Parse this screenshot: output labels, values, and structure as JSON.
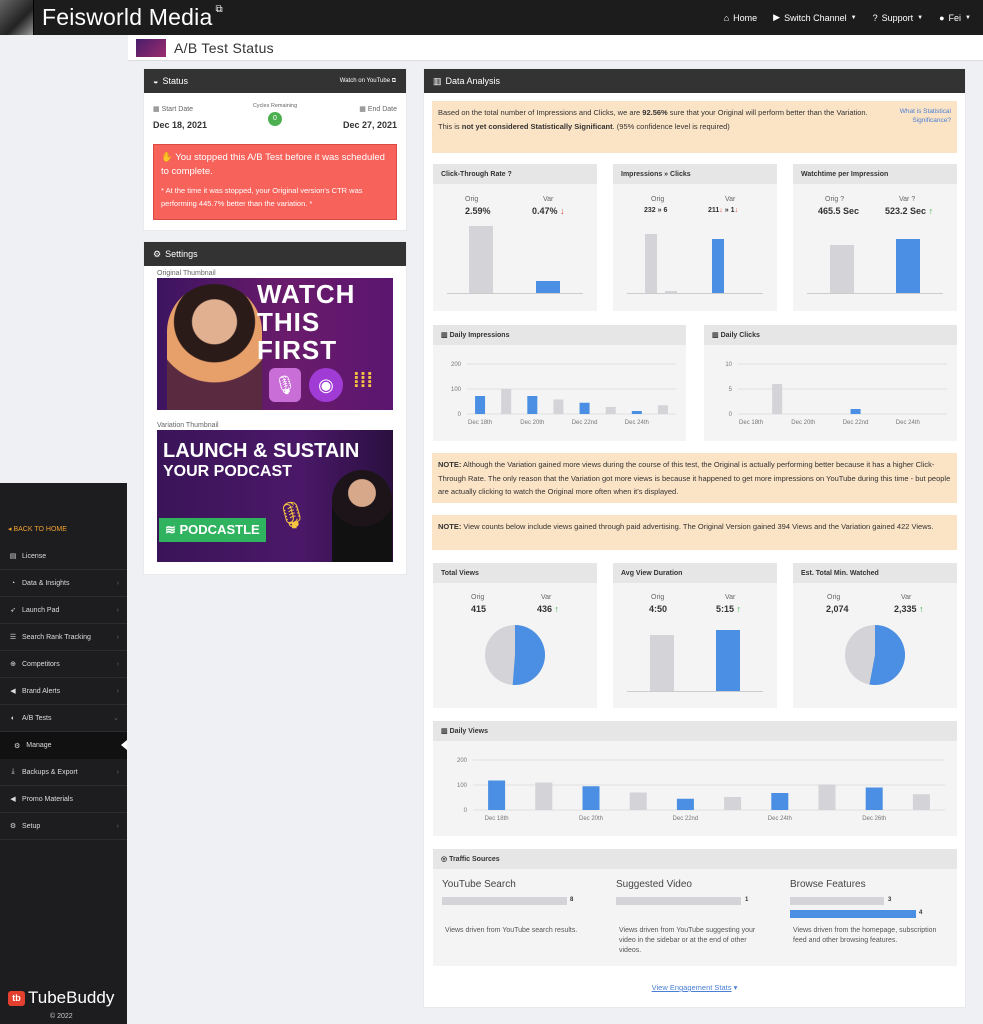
{
  "topbar": {
    "brand": "Feisworld Media",
    "home": "Home",
    "switch_channel": "Switch Channel",
    "support": "Support",
    "user": "Fei"
  },
  "subbar": {
    "title": "A/B Test Status"
  },
  "sidebar": {
    "back": "BACK TO HOME",
    "items": [
      "License",
      "Data & Insights",
      "Launch Pad",
      "Search Rank Tracking",
      "Competitors",
      "Brand Alerts",
      "A/B Tests",
      "Backups & Export",
      "Promo Materials",
      "Setup"
    ],
    "sub_manage": "Manage",
    "logo": "TubeBuddy",
    "copyright": "© 2022"
  },
  "status": {
    "title": "Status",
    "watch_link": "Watch on YouTube",
    "start_label": "Start Date",
    "start_date": "Dec 18, 2021",
    "cycles_label": "Cycles Remaining",
    "cycles": "0",
    "end_label": "End Date",
    "end_date": "Dec 27, 2021",
    "alert_main": "You stopped this A/B Test before it was scheduled to complete.",
    "alert_detail": "* At the time it was stopped, your Original version's CTR was performing 445.7% better than the variation. *"
  },
  "settings": {
    "title": "Settings",
    "orig_label": "Original Thumbnail",
    "var_label": "Variation Thumbnail",
    "orig_text": [
      "WATCH",
      "THIS",
      "FIRST"
    ],
    "var_text": [
      "LAUNCH & SUSTAIN",
      "YOUR PODCAST"
    ],
    "var_badge": "PODCASTLE"
  },
  "analysis": {
    "title": "Data Analysis",
    "summary_1": "Based on the total number of Impressions and Clicks, we are ",
    "summary_pct": "92.56%",
    "summary_2": " sure that your Original will perform better than the Variation.",
    "summary_3": "This is ",
    "summary_bold": "not yet considered Statistically Significant",
    "summary_4": ". (95% confidence level is required)",
    "what_is": "What is Statistical Significance?",
    "ctr": {
      "title": "Click-Through Rate",
      "orig_label": "Orig",
      "var_label": "Var",
      "orig": "2.59%",
      "var": "0.47%"
    },
    "imp_clicks": {
      "title": "Impressions » Clicks",
      "orig_label": "Orig",
      "var_label": "Var",
      "orig": "232 » 6",
      "var_imp": "211",
      "var_clicks": "1"
    },
    "watchtime": {
      "title": "Watchtime per Impression",
      "orig_label": "Orig",
      "var_label": "Var",
      "orig": "465.5 Sec",
      "var": "523.2 Sec"
    },
    "daily_impressions_title": "Daily Impressions",
    "daily_clicks_title": "Daily Clicks",
    "note1_bold": "NOTE:",
    "note1": " Although the Variation gained more views during the course of this test, the Original is actually performing better because it has a higher Click-Through Rate. The only reason that the Variation got more views is because it happened to get more impressions on YouTube during this time - but people are actually clicking to watch the Original more often when it's displayed.",
    "note2_bold": "NOTE:",
    "note2": " View counts below include views gained through paid advertising. The Original Version gained 394 Views and the Variation gained 422 Views.",
    "views": {
      "title": "Total Views",
      "orig_label": "Orig",
      "var_label": "Var",
      "orig": "415",
      "var": "436"
    },
    "avd": {
      "title": "Avg View Duration",
      "orig_label": "Orig",
      "var_label": "Var",
      "orig": "4:50",
      "var": "5:15"
    },
    "minutes": {
      "title": "Est. Total Min. Watched",
      "orig_label": "Orig",
      "var_label": "Var",
      "orig": "2,074",
      "var": "2,335"
    },
    "daily_views_title": "Daily Views",
    "traffic": {
      "title": "Traffic Sources",
      "yt_title": "YouTube Search",
      "yt_val": "8",
      "yt_desc": "Views driven from YouTube search results.",
      "sv_title": "Suggested Video",
      "sv_val": "1",
      "sv_desc": "Views driven from YouTube suggesting your video in the sidebar or at the end of other videos.",
      "bf_title": "Browse Features",
      "bf_val1": "3",
      "bf_val2": "4",
      "bf_desc": "Views driven from the homepage, subscription feed and other browsing features."
    },
    "engagement_link": "View Engagement Stats"
  },
  "colors": {
    "orig": "#d3d3d8",
    "var": "#4a8fe3",
    "accent": "#f0a030",
    "alert": "#f7625b"
  },
  "chart_data": [
    {
      "type": "bar",
      "title": "Daily Impressions",
      "categories": [
        "Dec 18th",
        "",
        "Dec 20th",
        "",
        "Dec 22nd",
        "",
        "Dec 24th",
        ""
      ],
      "series": [
        {
          "values": [
            72,
            0,
            72,
            0,
            45,
            0,
            12,
            0
          ]
        },
        {
          "values": [
            0,
            100,
            0,
            58,
            0,
            28,
            0,
            35
          ]
        }
      ],
      "ylim": [
        0,
        200
      ],
      "yticks": [
        "0",
        "100",
        "200"
      ]
    },
    {
      "type": "bar",
      "title": "Daily Clicks",
      "categories": [
        "Dec 18th",
        "",
        "Dec 20th",
        "",
        "Dec 22nd",
        "",
        "Dec 24th",
        ""
      ],
      "series": [
        {
          "values": [
            0,
            0,
            0,
            0,
            1,
            0,
            0,
            0
          ]
        },
        {
          "values": [
            0,
            6,
            0,
            0,
            0,
            0,
            0,
            0
          ]
        }
      ],
      "ylim": [
        0,
        10
      ],
      "yticks": [
        "0",
        "5",
        "10"
      ]
    },
    {
      "type": "bar",
      "title": "Daily Views",
      "categories": [
        "Dec 18th",
        "",
        "Dec 20th",
        "",
        "Dec 22nd",
        "",
        "Dec 24th",
        "",
        "Dec 26th",
        ""
      ],
      "series": [
        {
          "values": [
            118,
            0,
            95,
            0,
            45,
            0,
            68,
            0,
            90,
            0
          ]
        },
        {
          "values": [
            0,
            110,
            0,
            70,
            0,
            52,
            0,
            102,
            0,
            63
          ]
        }
      ],
      "ylim": [
        0,
        200
      ],
      "yticks": [
        "0",
        "100",
        "200"
      ]
    }
  ]
}
